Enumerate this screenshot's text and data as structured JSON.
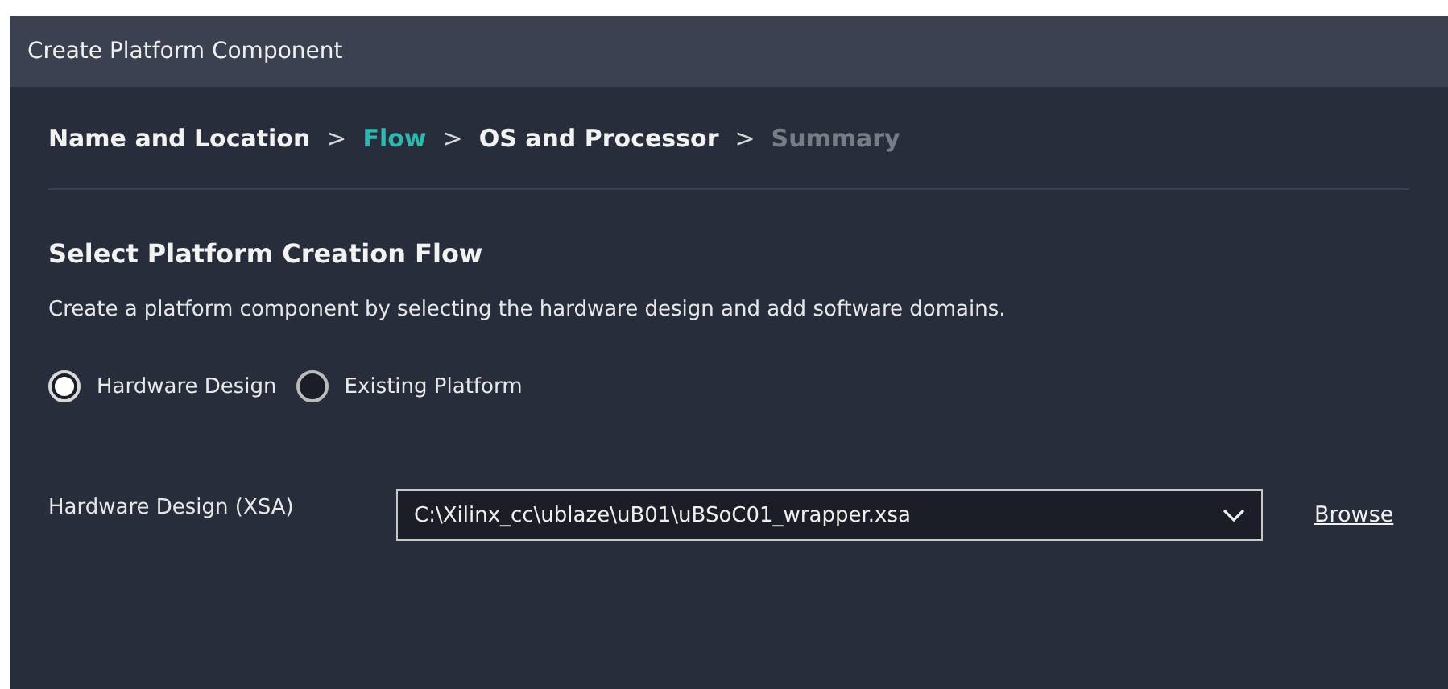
{
  "window": {
    "title": "Create Platform Component"
  },
  "steps": [
    {
      "label": "Name and Location",
      "selected": false,
      "disabled": false,
      "separator": ">"
    },
    {
      "label": "Flow",
      "selected": true,
      "disabled": false,
      "separator": ">"
    },
    {
      "label": "OS and Processor",
      "selected": false,
      "disabled": false,
      "separator": ">"
    },
    {
      "label": "Summary",
      "selected": false,
      "disabled": true
    }
  ],
  "heading": "Select Platform Creation Flow",
  "description": "Create a platform component by selecting the hardware design and add software domains.",
  "flow_options": [
    {
      "label": "Hardware Design",
      "selected": true
    },
    {
      "label": "Existing Platform",
      "selected": false
    }
  ],
  "hardware_design": {
    "label": "Hardware Design (XSA)",
    "value": "C:\\Xilinx_cc\\ublaze\\uB01\\uBSoC01_wrapper.xsa",
    "browse": "Browse"
  }
}
